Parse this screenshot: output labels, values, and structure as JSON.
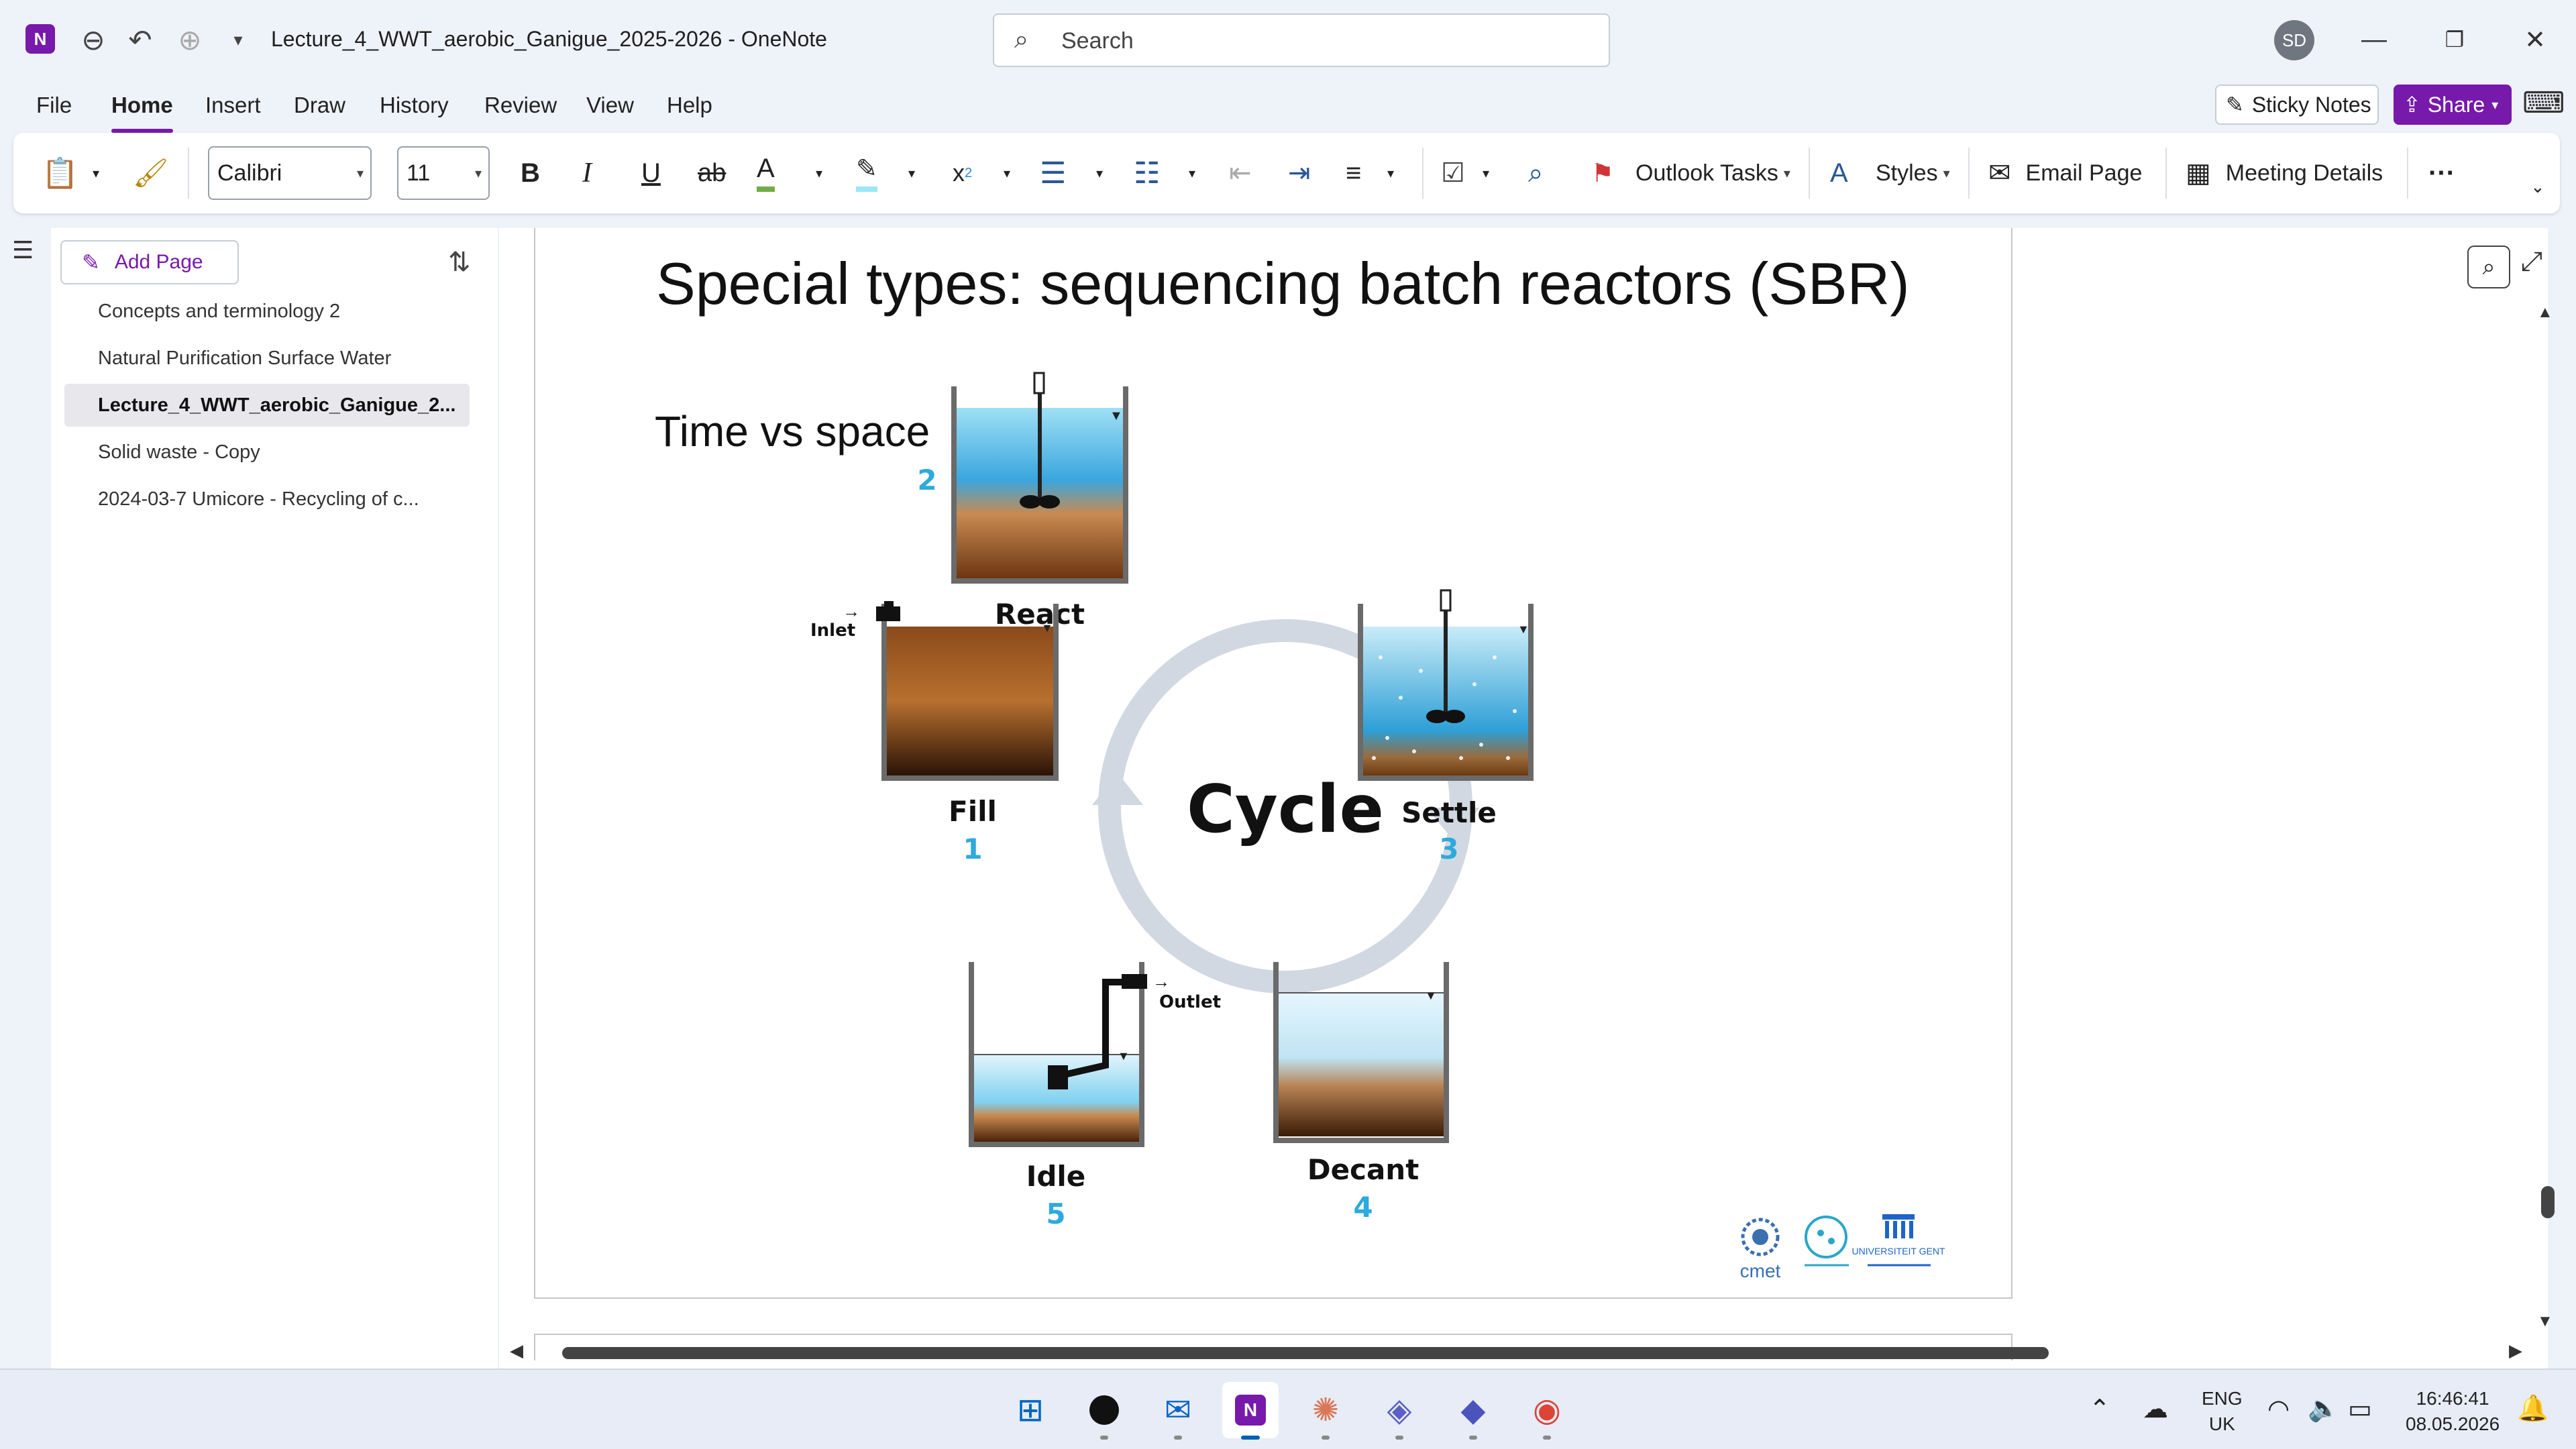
{
  "window": {
    "title": "Lecture_4_WWT_aerobic_Ganigue_2025-2026  -  OneNote",
    "app_logo": "N",
    "search_placeholder": "Search",
    "avatar_initials": "SD"
  },
  "menu": {
    "items": [
      "File",
      "Home",
      "Insert",
      "Draw",
      "History",
      "Review",
      "View",
      "Help"
    ],
    "active": "Home",
    "sticky_notes": "Sticky Notes",
    "share": "Share"
  },
  "ribbon": {
    "font_name": "Calibri",
    "font_size": "11",
    "bold": "B",
    "italic": "I",
    "underline": "U",
    "strike": "ab",
    "font_color": "A",
    "subscript": "x",
    "outlook_tasks": "Outlook Tasks",
    "styles": "Styles",
    "email_page": "Email Page",
    "meeting_details": "Meeting Details",
    "more": "···"
  },
  "nav": {
    "add_page": "Add Page",
    "pages": [
      "Concepts and terminology 2",
      "Natural Purification Surface Water",
      "Lecture_4_WWT_aerobic_Ganigue_2...",
      "Solid waste - Copy",
      "2024-03-7 Umicore - Recycling of c..."
    ],
    "selected_index": 2
  },
  "slide": {
    "title": "Special types: sequencing batch reactors (SBR)",
    "subtitle": "Time vs space",
    "cycle_label": "Cycle",
    "stages": {
      "fill": {
        "name": "Fill",
        "num": "1"
      },
      "react": {
        "name": "React",
        "num": "2"
      },
      "settle": {
        "name": "Settle",
        "num": "3"
      },
      "decant": {
        "name": "Decant",
        "num": "4"
      },
      "idle": {
        "name": "Idle",
        "num": "5"
      }
    },
    "inlet": "Inlet",
    "outlet": "Outlet",
    "logos": {
      "cmet": "cmet",
      "ugent": "UNIVERSITEIT GENT"
    }
  },
  "taskbar": {
    "lang_line1": "ENG",
    "lang_line2": "UK",
    "time": "16:46:41",
    "date": "08.05.2026"
  },
  "colors": {
    "accent": "#7719aa",
    "stage_number": "#2eaadc",
    "sludge": "#8b4a1c",
    "water": "#4fb8e4",
    "cycle_ring": "#d2d8e2"
  }
}
